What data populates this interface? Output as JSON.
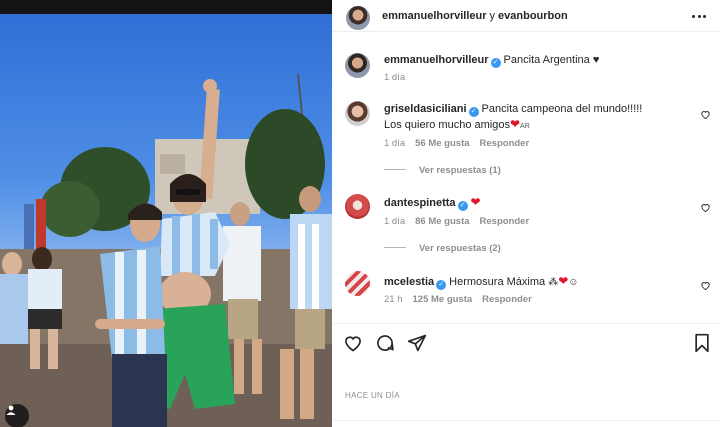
{
  "header": {
    "user1": "emmanuelhorvilleur",
    "separator": "y",
    "user2": "evanbourbon"
  },
  "caption": {
    "username": "emmanuelhorvilleur",
    "text": "Pancita Argentina ♥",
    "time": "1 día"
  },
  "comments": [
    {
      "username": "griseldasiciliani",
      "text": "Pancita campeona del mundo!!!!!",
      "text2": "Los quiero mucho amigos",
      "emoji": "❤",
      "suffix": "AR",
      "time": "1 día",
      "likes": "56 Me gusta",
      "reply": "Responder",
      "view_replies": "Ver respuestas (1)"
    },
    {
      "username": "dantespinetta",
      "emoji": "❤",
      "time": "1 día",
      "likes": "86 Me gusta",
      "reply": "Responder",
      "view_replies": "Ver respuestas (2)"
    },
    {
      "username": "mcelestia",
      "text": "Hermosura Máxima",
      "emoji": "❤",
      "time": "21 h",
      "likes": "125 Me gusta",
      "reply": "Responder"
    }
  ],
  "post_time": "HACE UN DÍA",
  "colors": {
    "verified": "#3897f0",
    "heart": "#e0162b",
    "muted": "#8e8e8e"
  },
  "icons": [
    "more-icon",
    "like-icon",
    "comment-icon",
    "share-icon",
    "save-icon",
    "comment-like-icon",
    "user-tag-icon"
  ]
}
